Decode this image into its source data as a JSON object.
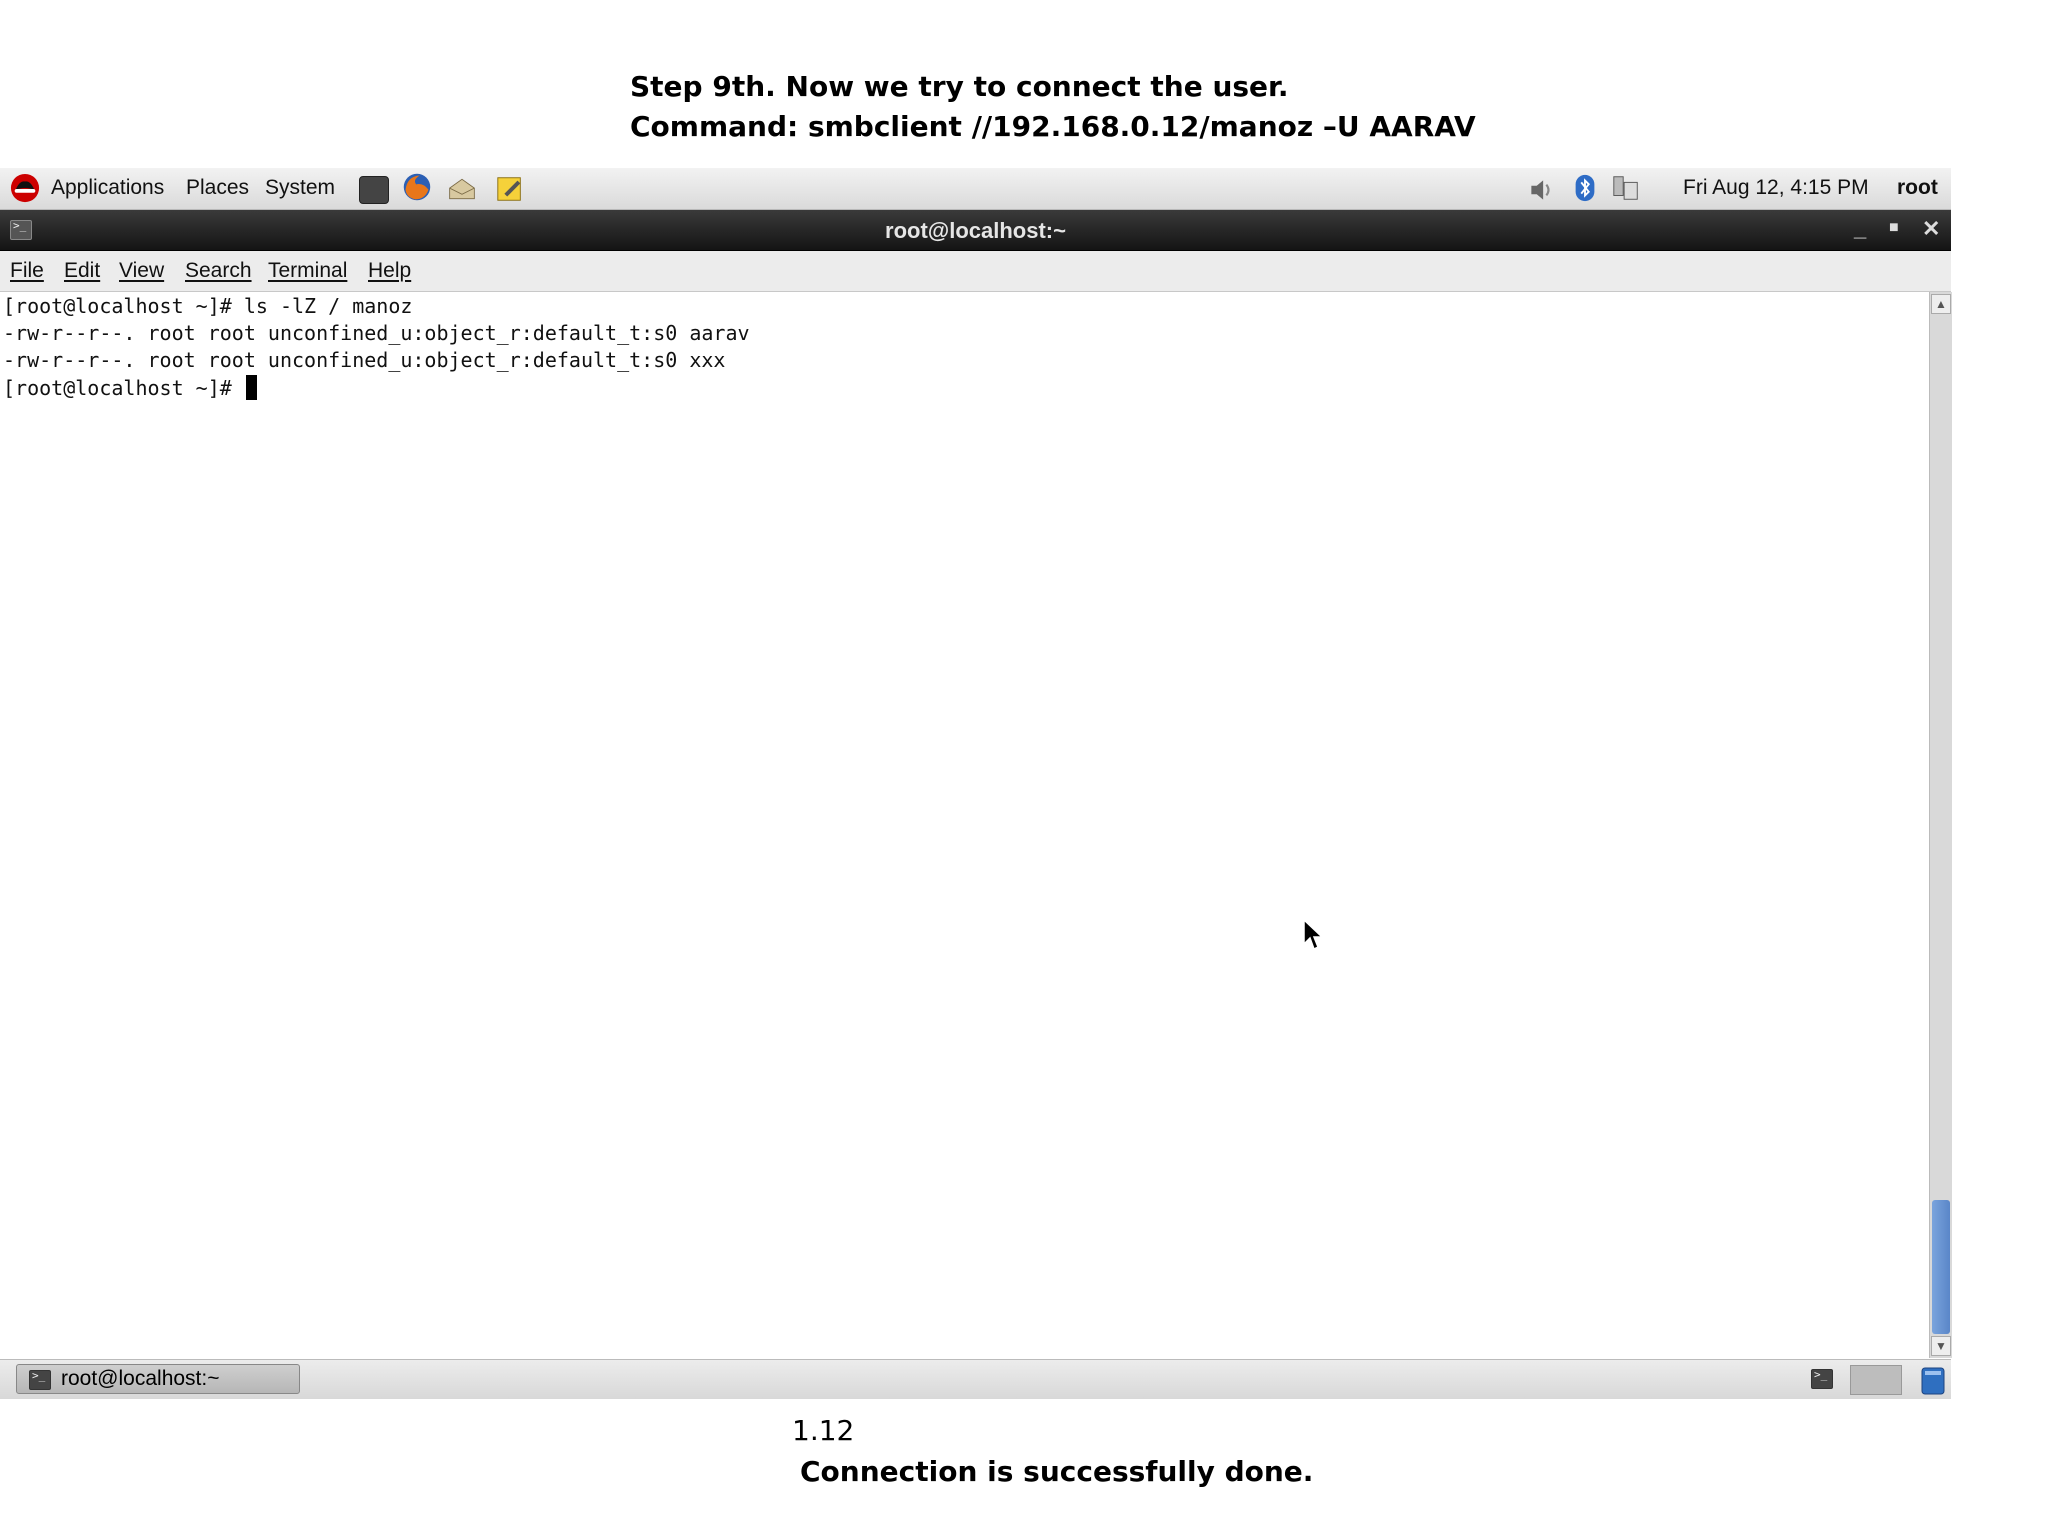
{
  "captions": {
    "step": "Step 9th. Now we try to connect the user.",
    "command": "Command: smbclient //192.168.0.12/manoz –U AARAV",
    "figure_number": "1.12",
    "result": "Connection is successfully done."
  },
  "top_panel": {
    "menus": [
      "Applications",
      "Places",
      "System"
    ],
    "launchers": [
      "terminal-icon",
      "firefox-icon",
      "mail-icon",
      "notes-icon"
    ],
    "tray_icons": [
      "volume-icon",
      "bluetooth-icon",
      "network-icon"
    ],
    "datetime": "Fri Aug 12,  4:15 PM",
    "user": "root"
  },
  "window": {
    "title": "root@localhost:~",
    "menu": [
      "File",
      "Edit",
      "View",
      "Search",
      "Terminal",
      "Help"
    ]
  },
  "terminal": {
    "lines": [
      "[root@localhost ~]# ls -lZ / manoz",
      "-rw-r--r--. root root unconfined_u:object_r:default_t:s0 aarav",
      "-rw-r--r--. root root unconfined_u:object_r:default_t:s0 xxx"
    ],
    "prompt": "[root@localhost ~]# "
  },
  "taskbar": {
    "task_label": "root@localhost:~"
  },
  "colors": {
    "titlebar": "#1e1e1e",
    "scroll_thumb": "#6a94d4"
  }
}
